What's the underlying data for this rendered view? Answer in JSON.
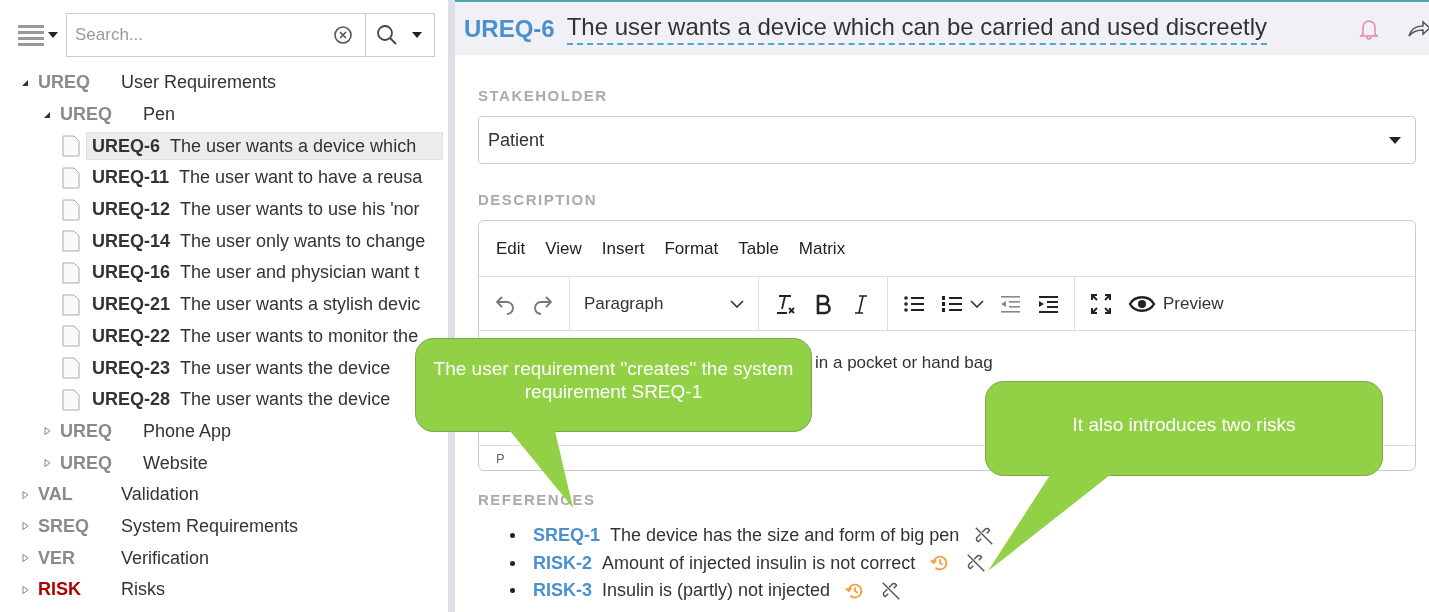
{
  "sidebar": {
    "search": {
      "placeholder": "Search..."
    },
    "tree": [
      {
        "code": "UREQ",
        "label": "User Requirements",
        "color": "#8a8a8a",
        "expanded": true,
        "children": [
          {
            "code": "UREQ",
            "label": "Pen",
            "color": "#8a8a8a",
            "expanded": true,
            "items": [
              {
                "id": "UREQ-6",
                "text": "The user wants a device which",
                "selected": true
              },
              {
                "id": "UREQ-11",
                "text": "The user want to have a reusa",
                "selected": false
              },
              {
                "id": "UREQ-12",
                "text": "The user wants to use his 'nor",
                "selected": false
              },
              {
                "id": "UREQ-14",
                "text": "The user only wants to change",
                "selected": false
              },
              {
                "id": "UREQ-16",
                "text": "The user and physician want t",
                "selected": false
              },
              {
                "id": "UREQ-21",
                "text": "The user wants a stylish devic",
                "selected": false
              },
              {
                "id": "UREQ-22",
                "text": "The user wants to monitor the",
                "selected": false
              },
              {
                "id": "UREQ-23",
                "text": "The user wants the device",
                "selected": false
              },
              {
                "id": "UREQ-28",
                "text": "The user wants the device",
                "selected": false
              }
            ]
          },
          {
            "code": "UREQ",
            "label": "Phone App",
            "color": "#8a8a8a",
            "expanded": false
          },
          {
            "code": "UREQ",
            "label": "Website",
            "color": "#8a8a8a",
            "expanded": false
          }
        ]
      },
      {
        "code": "VAL",
        "label": "Validation",
        "color": "#8a8a8a",
        "expanded": false
      },
      {
        "code": "SREQ",
        "label": "System Requirements",
        "color": "#8a8a8a",
        "expanded": false
      },
      {
        "code": "VER",
        "label": "Verification",
        "color": "#8a8a8a",
        "expanded": false
      },
      {
        "code": "RISK",
        "label": "Risks",
        "color": "#b00000",
        "expanded": false
      }
    ]
  },
  "item": {
    "id": "UREQ-6",
    "title": "The user wants a device which can be carried and used discreetly",
    "stakeholder": {
      "label": "STAKEHOLDER",
      "value": "Patient"
    },
    "description": {
      "label": "DESCRIPTION",
      "menu": [
        "Edit",
        "View",
        "Insert",
        "Format",
        "Table",
        "Matrix"
      ],
      "block_format": "Paragraph",
      "preview": "Preview",
      "text": "in a pocket or hand bag",
      "status": "P"
    },
    "references": {
      "label": "REFERENCES",
      "items": [
        {
          "id": "SREQ-1",
          "text": "The device has the size and form of big pen",
          "unlink": true
        },
        {
          "id": "RISK-2",
          "text": "Amount of injected insulin is not correct",
          "history": true,
          "unlink": true
        },
        {
          "id": "RISK-3",
          "text": "Insulin is (partly) not injected",
          "history": true,
          "unlink": true
        }
      ]
    }
  },
  "callouts": [
    {
      "text": "The user requirement \"creates\" the system requirement SREQ-1"
    },
    {
      "text": "It also introduces two risks"
    }
  ]
}
